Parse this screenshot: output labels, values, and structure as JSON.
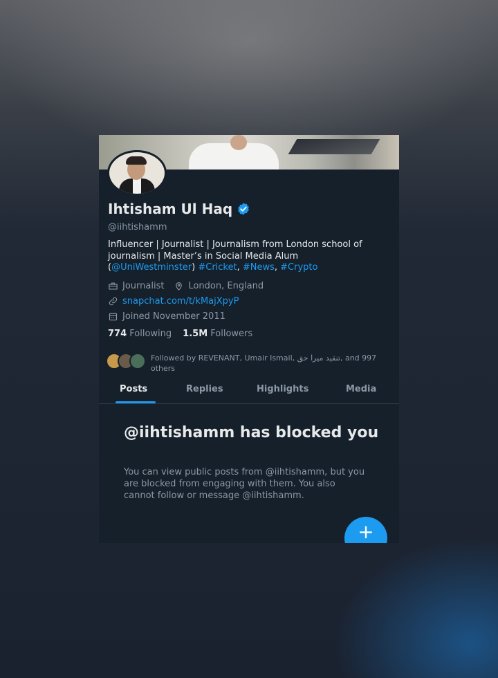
{
  "profile": {
    "name": "Ihtisham Ul Haq",
    "handle": "@iihtishamm",
    "bio_text_1": "Influencer | Journalist | Journalism from London school of journalism | Master’s in Social Media Alum (",
    "bio_mention": "@UniWestminster",
    "bio_text_2": ") ",
    "bio_tag_1": "#Cricket",
    "bio_sep_1": ", ",
    "bio_tag_2": "#News",
    "bio_sep_2": ", ",
    "bio_tag_3": "#Crypto",
    "profession": "Journalist",
    "location": "London, England",
    "website": "snapchat.com/t/kMajXpyP",
    "joined": "Joined November 2011"
  },
  "stats": {
    "following_count": "774",
    "following_label": "Following",
    "followers_count": "1.5M",
    "followers_label": "Followers"
  },
  "followed_by": "Followed by REVENANT, Umair Ismail, تنقید میرا حق, and 997 others",
  "tabs": [
    {
      "label": "Posts"
    },
    {
      "label": "Replies"
    },
    {
      "label": "Highlights"
    },
    {
      "label": "Media"
    }
  ],
  "blocked": {
    "title": "@iihtishamm has blocked you",
    "description": "You can view public posts from @iihtishamm, but you are blocked from engaging with them. You also cannot follow or message @iihtishamm."
  },
  "fab": {
    "icon": "plus-icon",
    "label": "+"
  },
  "colors": {
    "accent": "#1d9bf0",
    "background": "#15202b",
    "secondary_text": "#8b98a5"
  }
}
